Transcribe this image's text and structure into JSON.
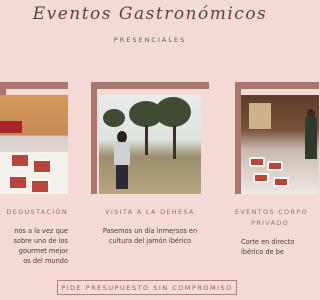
{
  "header": {
    "title": "Eventos Gastronómicos",
    "subtitle": "PRESENCIALES"
  },
  "cards": [
    {
      "title": "DEGUSTACIÓN",
      "lines": [
        "nos a la vez que",
        "sobre uno de los",
        "gourmet mejor",
        "os del mundo"
      ]
    },
    {
      "title": "VISITA A LA DEHESA",
      "lines": [
        "Pasemos un día inmersos en",
        "cultura del jamón ibérico"
      ]
    },
    {
      "title": "EVENTOS CORPO",
      "subtitle": "PRIVADO",
      "lines": [
        "Corte en directo",
        "ibérico de be"
      ]
    }
  ],
  "cta": {
    "label": "PIDE PRESUPUESTO SIN COMPROMISO"
  },
  "colors": {
    "background": "#f3dad6",
    "accent": "#a97670",
    "heading": "#a06b60"
  }
}
